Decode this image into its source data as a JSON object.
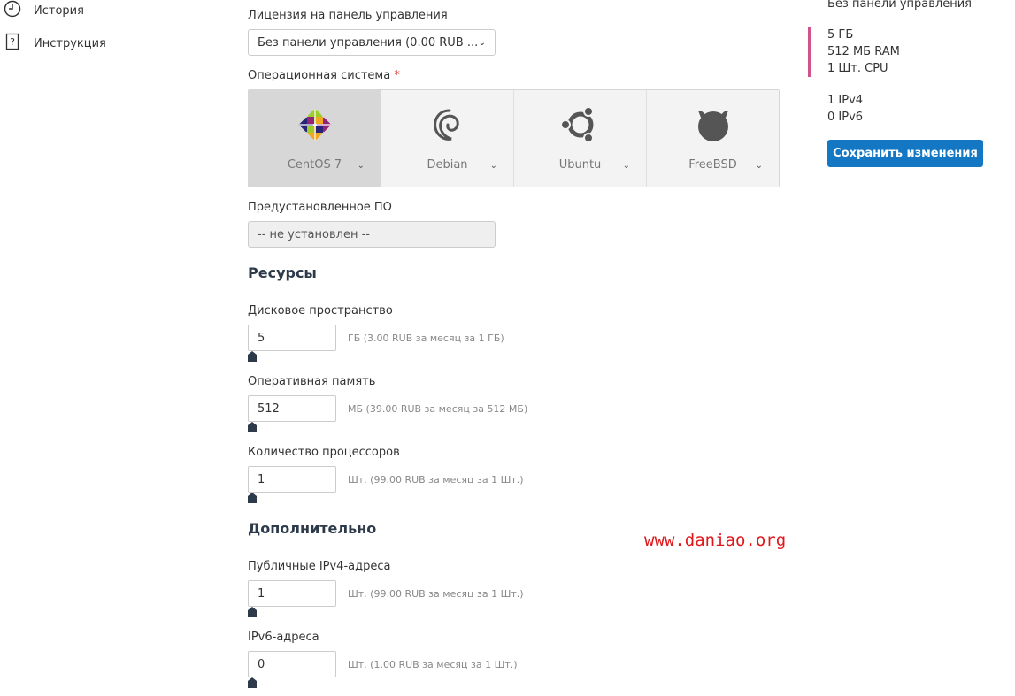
{
  "sidebar": {
    "items": [
      {
        "label": "История",
        "icon": "history-icon"
      },
      {
        "label": "Инструкция",
        "icon": "help-doc-icon"
      }
    ]
  },
  "form": {
    "license": {
      "label": "Лицензия на панель управления",
      "value": "Без панели управления (0.00 RUB ..."
    },
    "os": {
      "label": "Операционная система",
      "required_mark": "*",
      "options": [
        {
          "name": "CentOS 7",
          "icon": "centos-logo-icon",
          "selected": true
        },
        {
          "name": "Debian",
          "icon": "debian-logo-icon",
          "selected": false
        },
        {
          "name": "Ubuntu",
          "icon": "ubuntu-logo-icon",
          "selected": false
        },
        {
          "name": "FreeBSD",
          "icon": "freebsd-logo-icon",
          "selected": false
        }
      ]
    },
    "preinstalled": {
      "label": "Предустановленное ПО",
      "value": "-- не установлен --"
    },
    "resources_title": "Ресурсы",
    "disk": {
      "label": "Дисковое пространство",
      "value": "5",
      "hint": "ГБ (3.00 RUB за месяц за 1 ГБ)",
      "slider_fraction": 0
    },
    "ram": {
      "label": "Оперативная память",
      "value": "512",
      "hint": "МБ (39.00 RUB за месяц за 512 МБ)",
      "slider_fraction": 0
    },
    "cpu": {
      "label": "Количество процессоров",
      "value": "1",
      "hint": "Шт. (99.00 RUB за месяц за 1 Шт.)",
      "slider_fraction": 0
    },
    "extra_title": "Дополнительно",
    "ipv4": {
      "label": "Публичные IPv4-адреса",
      "value": "1",
      "hint": "Шт. (99.00 RUB за месяц за 1 Шт.)",
      "slider_fraction": 0
    },
    "ipv6": {
      "label": "IPv6-адреса",
      "value": "0",
      "hint": "Шт. (1.00 RUB за месяц за 1 Шт.)",
      "slider_fraction": 0
    }
  },
  "summary": {
    "panel": "Без панели управления",
    "disk": "5 ГБ",
    "ram": "512 МБ RAM",
    "cpu": "1 Шт. CPU",
    "ipv4": "1 IPv4",
    "ipv6": "0 IPv6",
    "accent_color": "#d2528c",
    "save_label": "Сохранить изменения",
    "button_color": "#1477c4"
  },
  "watermark": "www.daniao.org"
}
